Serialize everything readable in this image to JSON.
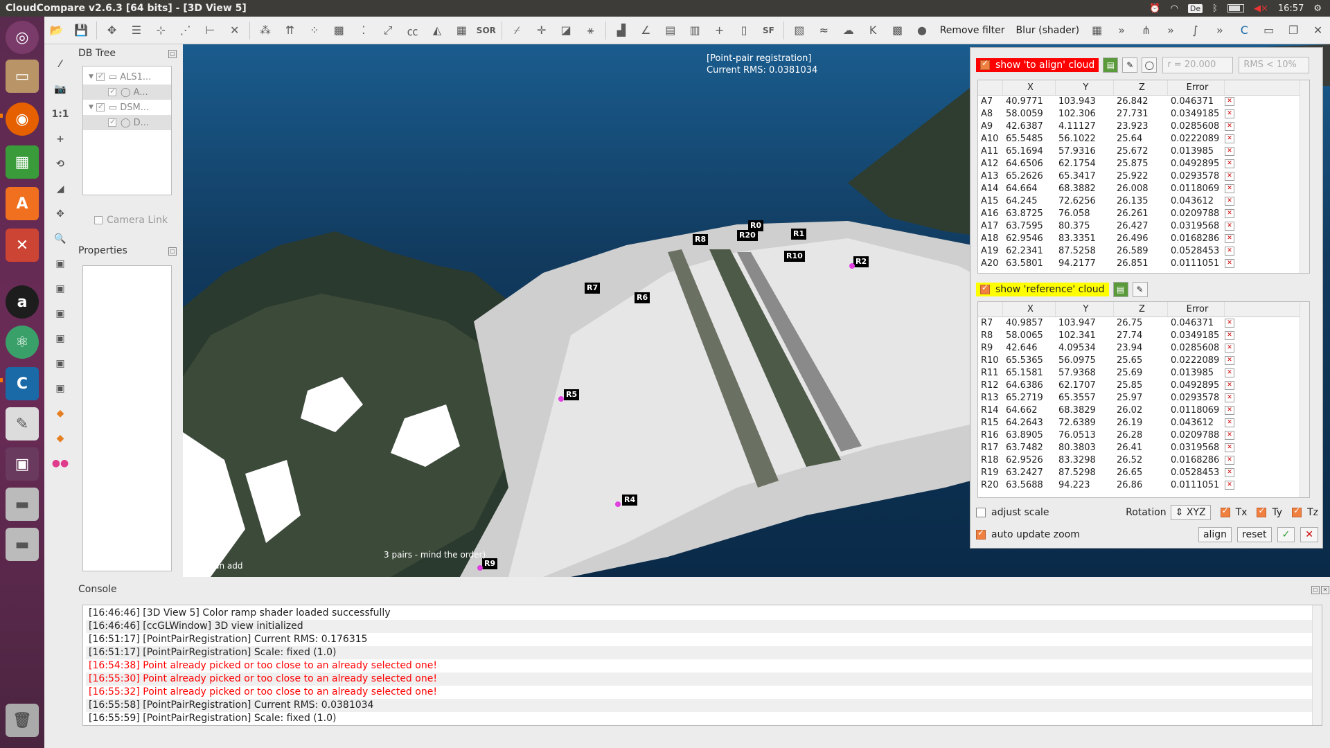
{
  "window": {
    "title": "CloudCompare v2.6.3 [64 bits] - [3D View 5]",
    "clock": "16:57",
    "keyboard": "De"
  },
  "launcher": {
    "items": [
      "ubuntu-logo-icon",
      "files-icon",
      "firefox-icon",
      "spreadsheet-icon",
      "software-center-icon",
      "settings-icon",
      "amazon-icon",
      "atom-icon",
      "cloudcompare-icon",
      "text-editor-icon",
      "workspace-icon",
      "drive-icon",
      "drive-icon",
      "trash-icon"
    ]
  },
  "toolbar": {
    "remove_filter": "Remove filter",
    "blur_shader": "Blur (shader)",
    "sor_label": "SOR",
    "sf_label": "SF"
  },
  "dbtree": {
    "title": "DB Tree",
    "items": [
      {
        "label": "ALS1...",
        "level": 0
      },
      {
        "label": "A...",
        "level": 1
      },
      {
        "label": "DSM...",
        "level": 0
      },
      {
        "label": "D...",
        "level": 1
      }
    ],
    "camera_link": "Camera Link"
  },
  "properties": {
    "title": "Properties"
  },
  "view3d": {
    "overlay_line1": "[Point-pair registration]",
    "overlay_line2": "Current RMS: 0.0381034",
    "hint_line1": "3 pairs - mind the order)",
    "hint_line2": "(you can add",
    "markers": [
      "R0",
      "R20",
      "R1",
      "R8",
      "R2",
      "R7",
      "R6",
      "R5",
      "R4",
      "R9",
      "R10"
    ]
  },
  "registration": {
    "align_toggle": "show 'to align' cloud",
    "radius": "r = 20.000",
    "rms_limit": "RMS < 10%",
    "reference_toggle": "show 'reference' cloud",
    "headers": [
      "",
      "X",
      "Y",
      "Z",
      "Error"
    ],
    "align_rows": [
      [
        "A7",
        "40.9771",
        "103.943",
        "26.842",
        "0.046371"
      ],
      [
        "A8",
        "58.0059",
        "102.306",
        "27.731",
        "0.0349185"
      ],
      [
        "A9",
        "42.6387",
        "4.11127",
        "23.923",
        "0.0285608"
      ],
      [
        "A10",
        "65.5485",
        "56.1022",
        "25.64",
        "0.0222089"
      ],
      [
        "A11",
        "65.1694",
        "57.9316",
        "25.672",
        "0.013985"
      ],
      [
        "A12",
        "64.6506",
        "62.1754",
        "25.875",
        "0.0492895"
      ],
      [
        "A13",
        "65.2626",
        "65.3417",
        "25.922",
        "0.0293578"
      ],
      [
        "A14",
        "64.664",
        "68.3882",
        "26.008",
        "0.0118069"
      ],
      [
        "A15",
        "64.245",
        "72.6256",
        "26.135",
        "0.043612"
      ],
      [
        "A16",
        "63.8725",
        "76.058",
        "26.261",
        "0.0209788"
      ],
      [
        "A17",
        "63.7595",
        "80.375",
        "26.427",
        "0.0319568"
      ],
      [
        "A18",
        "62.9546",
        "83.3351",
        "26.496",
        "0.0168286"
      ],
      [
        "A19",
        "62.2341",
        "87.5258",
        "26.589",
        "0.0528453"
      ],
      [
        "A20",
        "63.5801",
        "94.2177",
        "26.851",
        "0.0111051"
      ]
    ],
    "reference_rows": [
      [
        "R7",
        "40.9857",
        "103.947",
        "26.75",
        "0.046371"
      ],
      [
        "R8",
        "58.0065",
        "102.341",
        "27.74",
        "0.0349185"
      ],
      [
        "R9",
        "42.646",
        "4.09534",
        "23.94",
        "0.0285608"
      ],
      [
        "R10",
        "65.5365",
        "56.0975",
        "25.65",
        "0.0222089"
      ],
      [
        "R11",
        "65.1581",
        "57.9368",
        "25.69",
        "0.013985"
      ],
      [
        "R12",
        "64.6386",
        "62.1707",
        "25.85",
        "0.0492895"
      ],
      [
        "R13",
        "65.2719",
        "65.3557",
        "25.97",
        "0.0293578"
      ],
      [
        "R14",
        "64.662",
        "68.3829",
        "26.02",
        "0.0118069"
      ],
      [
        "R15",
        "64.2643",
        "72.6389",
        "26.19",
        "0.043612"
      ],
      [
        "R16",
        "63.8905",
        "76.0513",
        "26.28",
        "0.0209788"
      ],
      [
        "R17",
        "63.7482",
        "80.3803",
        "26.41",
        "0.0319568"
      ],
      [
        "R18",
        "62.9526",
        "83.3298",
        "26.52",
        "0.0168286"
      ],
      [
        "R19",
        "63.2427",
        "87.5298",
        "26.65",
        "0.0528453"
      ],
      [
        "R20",
        "63.5688",
        "94.223",
        "26.86",
        "0.0111051"
      ]
    ],
    "adjust_scale": "adjust scale",
    "rotation_label": "Rotation",
    "rotation_value": "XYZ",
    "tx": "Tx",
    "ty": "Ty",
    "tz": "Tz",
    "auto_update_zoom": "auto update zoom",
    "align_btn": "align",
    "reset_btn": "reset"
  },
  "console": {
    "title": "Console",
    "lines": [
      {
        "text": "[16:46:46] [3D View 5] Color ramp shader loaded successfully",
        "error": false
      },
      {
        "text": "[16:46:46] [ccGLWindow] 3D view initialized",
        "error": false
      },
      {
        "text": "[16:51:17] [PointPairRegistration] Current RMS: 0.176315",
        "error": false
      },
      {
        "text": "[16:51:17] [PointPairRegistration] Scale: fixed (1.0)",
        "error": false
      },
      {
        "text": "[16:54:38] Point already picked or too close to an already selected one!",
        "error": true
      },
      {
        "text": "[16:55:30] Point already picked or too close to an already selected one!",
        "error": true
      },
      {
        "text": "[16:55:32] Point already picked or too close to an already selected one!",
        "error": true
      },
      {
        "text": "[16:55:58] [PointPairRegistration] Current RMS: 0.0381034",
        "error": false
      },
      {
        "text": "[16:55:59] [PointPairRegistration] Scale: fixed (1.0)",
        "error": false
      }
    ]
  },
  "colors": {
    "error_text": "#ff0000",
    "align_tag": "#ff0000",
    "reference_tag": "#ffff00",
    "launcher": "#5b2a4f"
  }
}
